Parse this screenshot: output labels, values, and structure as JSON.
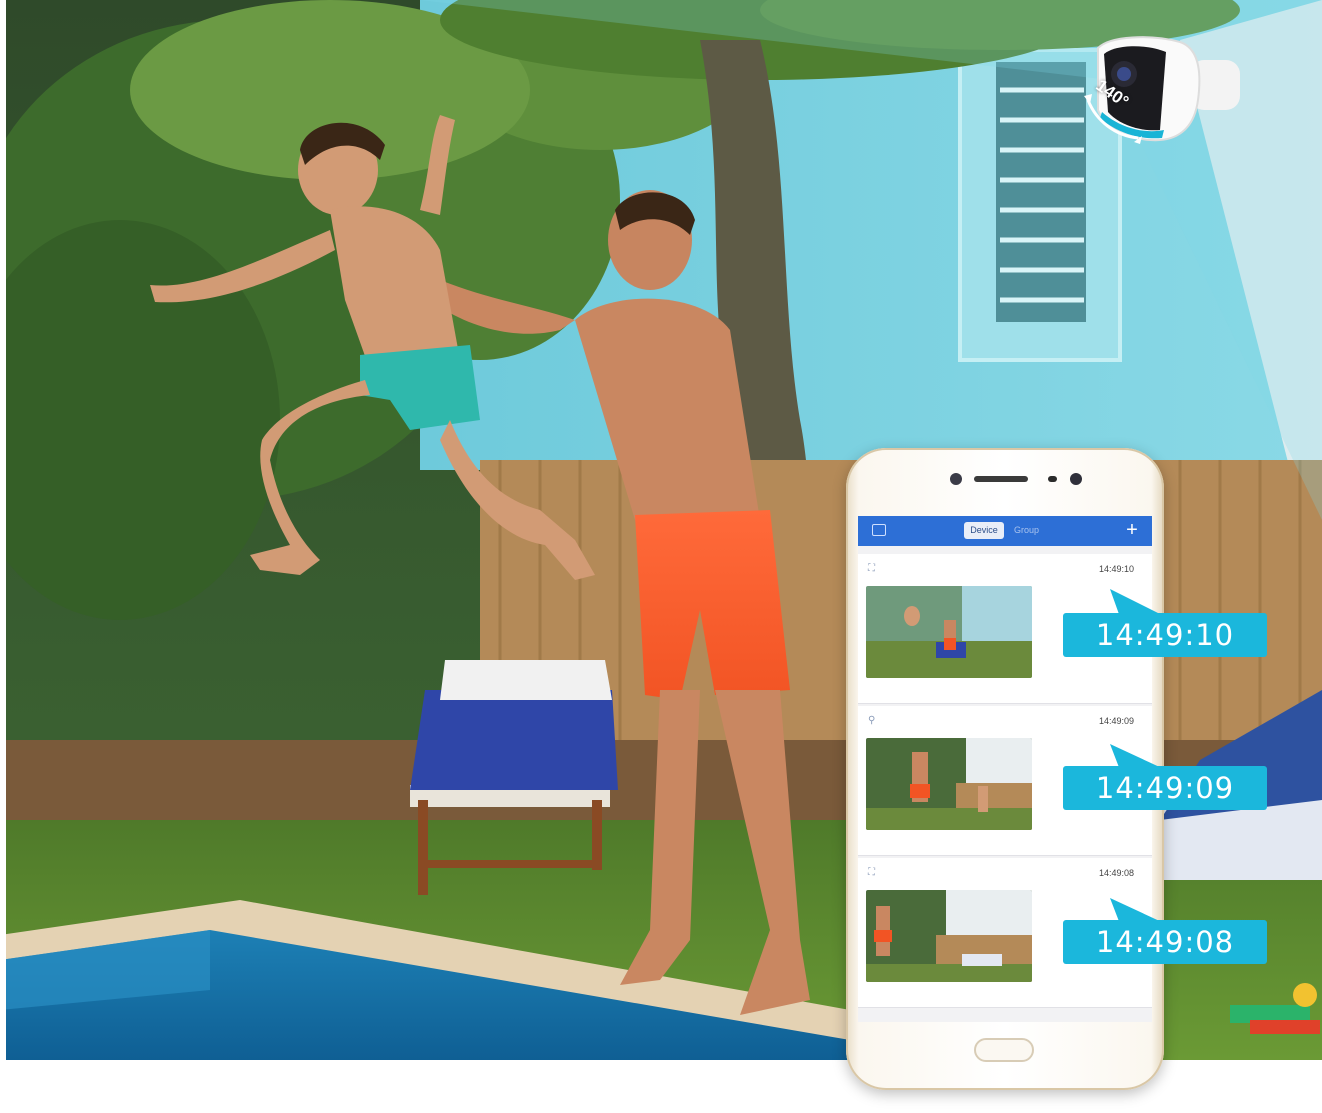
{
  "camera": {
    "fov_label": "140°"
  },
  "app": {
    "header": {
      "tab_device": "Device",
      "tab_group": "Group",
      "add_icon": "plus-icon",
      "message_icon": "message-icon"
    },
    "records": [
      {
        "time": "14:49:10"
      },
      {
        "time": "14:49:09"
      },
      {
        "time": "14:49:08"
      }
    ]
  },
  "callouts": [
    "14:49:10",
    "14:49:09",
    "14:49:08"
  ],
  "colors": {
    "accent": "#1bb7dc",
    "app_header": "#2d6fd6",
    "fov_overlay": "#7fd6e6"
  }
}
